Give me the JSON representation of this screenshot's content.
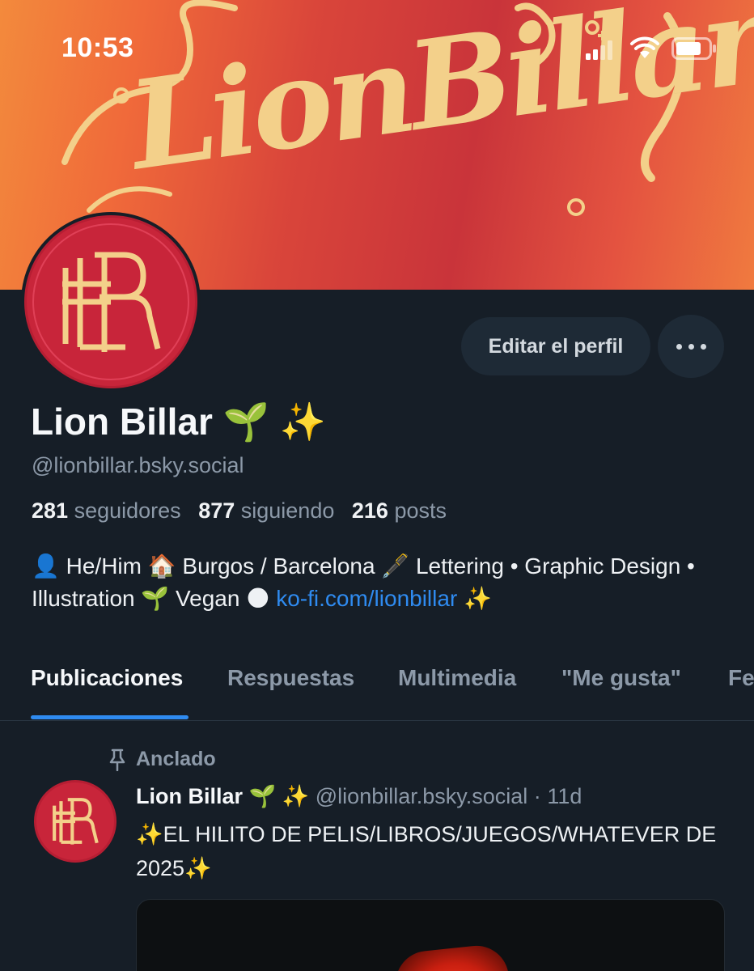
{
  "status_bar": {
    "time": "10:53",
    "icons": [
      "signal-icon",
      "wifi-icon",
      "battery-icon"
    ]
  },
  "banner": {
    "wordmark": "LionBillar!",
    "colors": {
      "background": "#d9453a",
      "lettering": "#f3d08a"
    }
  },
  "profile": {
    "avatar_monogram": "LBR",
    "display_name": "Lion Billar 🌱 ✨",
    "handle": "@lionbillar.bsky.social",
    "stats": [
      {
        "count": "281",
        "label": "seguidores"
      },
      {
        "count": "877",
        "label": "siguiendo"
      },
      {
        "count": "216",
        "label": "posts"
      }
    ],
    "bio_text": "👤 He/Him 🏠 Burgos / Barcelona 🖋️ Lettering • Graphic Design • Illustration 🌱 Vegan 🌑 ",
    "bio_link": "ko-fi.com/lionbillar",
    "bio_suffix": " ✨"
  },
  "actions": {
    "edit_label": "Editar el perfil",
    "more_label": "•••"
  },
  "tabs": [
    {
      "label": "Publicaciones",
      "active": true
    },
    {
      "label": "Respuestas",
      "active": false
    },
    {
      "label": "Multimedia",
      "active": false
    },
    {
      "label": "\"Me gusta\"",
      "active": false
    },
    {
      "label": "Fe",
      "active": false
    }
  ],
  "post": {
    "pinned_label": "Anclado",
    "author": "Lion Billar 🌱 ✨",
    "handle": "@lionbillar.bsky.social",
    "separator": "·",
    "time": "11d",
    "text": "✨EL HILITO DE PELIS/LIBROS/JUEGOS/WHATEVER DE 2025✨"
  },
  "colors": {
    "background": "#161e27",
    "accent": "#2f8bf0",
    "muted_text": "#8c99a8",
    "button_bg": "#1e2a36"
  }
}
